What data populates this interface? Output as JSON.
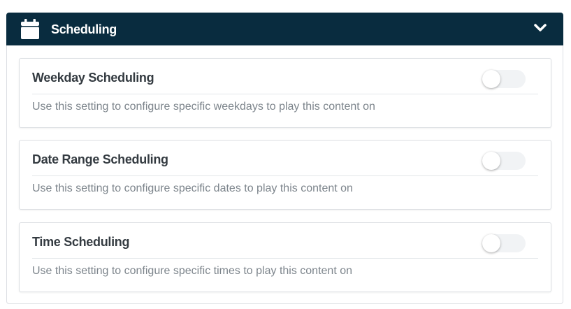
{
  "panel": {
    "title": "Scheduling",
    "header_icon": "calendar-icon",
    "collapse_icon": "chevron-down-icon",
    "header_color": "#092c3f"
  },
  "cards": [
    {
      "title": "Weekday Scheduling",
      "description": "Use this setting to configure specific weekdays to play this content on",
      "enabled": false
    },
    {
      "title": "Date Range Scheduling",
      "description": "Use this setting to configure specific dates to play this content on",
      "enabled": false
    },
    {
      "title": "Time Scheduling",
      "description": "Use this setting to configure specific times to play this content on",
      "enabled": false
    }
  ]
}
